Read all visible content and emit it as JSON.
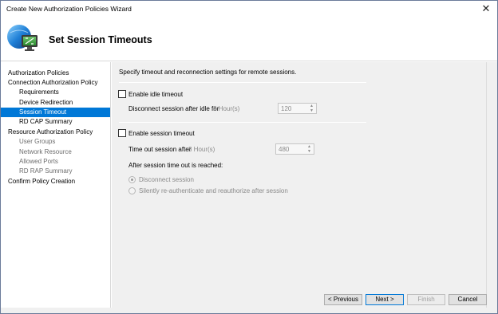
{
  "window": {
    "title": "Create New Authorization Policies Wizard",
    "close_label": "✕"
  },
  "header": {
    "title": "Set Session Timeouts",
    "icon": "remote-desktop-icon"
  },
  "sidebar": {
    "items": [
      {
        "label": "Authorization Policies",
        "level": 0,
        "state": "normal"
      },
      {
        "label": "Connection Authorization Policy",
        "level": 0,
        "state": "normal"
      },
      {
        "label": "Requirements",
        "level": 1,
        "state": "normal"
      },
      {
        "label": "Device Redirection",
        "level": 1,
        "state": "normal"
      },
      {
        "label": "Session Timeout",
        "level": 1,
        "state": "selected"
      },
      {
        "label": "RD CAP Summary",
        "level": 1,
        "state": "normal"
      },
      {
        "label": "Resource Authorization Policy",
        "level": 0,
        "state": "normal"
      },
      {
        "label": "User Groups",
        "level": 1,
        "state": "dim"
      },
      {
        "label": "Network Resource",
        "level": 1,
        "state": "dim"
      },
      {
        "label": "Allowed Ports",
        "level": 1,
        "state": "dim"
      },
      {
        "label": "RD RAP Summary",
        "level": 1,
        "state": "dim"
      },
      {
        "label": "Confirm Policy Creation",
        "level": 0,
        "state": "normal"
      }
    ]
  },
  "main": {
    "description": "Specify timeout and reconnection settings for remote sessions.",
    "idle": {
      "checkbox_label": "Enable idle timeout",
      "checked": false,
      "disconnect_label": "Disconnect session after idle for",
      "hint": "2 Hour(s)",
      "value": "120"
    },
    "session": {
      "checkbox_label": "Enable session timeout",
      "checked": false,
      "timeout_label": "Time out session after",
      "hint": "8 Hour(s)",
      "value": "480",
      "after_label": "After session time out is reached:",
      "options": [
        {
          "label": "Disconnect session",
          "checked": true
        },
        {
          "label": "Silently re-authenticate and reauthorize after session",
          "checked": false
        }
      ]
    }
  },
  "footer": {
    "previous": "< Previous",
    "next": "Next >",
    "finish": "Finish",
    "cancel": "Cancel"
  },
  "colors": {
    "selection": "#0078d7",
    "content_bg": "#f0f0f0"
  }
}
